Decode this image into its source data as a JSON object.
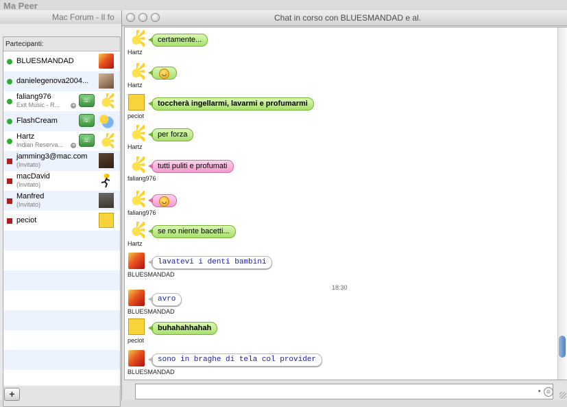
{
  "desktop": {
    "title": "Ma Peer"
  },
  "background_window": {
    "title": "Mac Forum - Il fo"
  },
  "chat_window": {
    "title": "Chat in corso con BLUESMANDAD e al."
  },
  "participants": {
    "label": "Partecipanti:",
    "items": [
      {
        "name": "BLUESMANDAD",
        "sub": "",
        "status": "online",
        "phone": false
      },
      {
        "name": "danielegenova2004...",
        "sub": "",
        "status": "online",
        "phone": false
      },
      {
        "name": "faliang976",
        "sub": "Exit Music - R...",
        "status": "online",
        "phone": true
      },
      {
        "name": "FlashCream",
        "sub": "",
        "status": "online",
        "phone": true
      },
      {
        "name": "Hartz",
        "sub": "Indian Reserva...",
        "status": "online",
        "phone": true
      },
      {
        "name": "jamming3@mac.com",
        "sub": "(Invitato)",
        "status": "invited",
        "phone": false
      },
      {
        "name": "macDavid",
        "sub": "(Invitato)",
        "status": "invited",
        "phone": false
      },
      {
        "name": "Manfred",
        "sub": "(Invitato)",
        "status": "invited",
        "phone": false
      },
      {
        "name": "peciot",
        "sub": "",
        "status": "invited",
        "phone": false
      }
    ],
    "add_label": "+"
  },
  "messages": [
    {
      "sender": "Hartz",
      "text": "certamente...",
      "style": "green"
    },
    {
      "sender": "Hartz",
      "text": "",
      "style": "green",
      "smiley": true
    },
    {
      "sender": "peciot",
      "text": "toccherà ingellarmi, lavarmi e profumarmi",
      "style": "green-bold"
    },
    {
      "sender": "Hartz",
      "text": "per forza",
      "style": "green"
    },
    {
      "sender": "faliang976",
      "text": "tutti puliti e profumati",
      "style": "pink"
    },
    {
      "sender": "faliang976",
      "text": "",
      "style": "pink",
      "smiley": true
    },
    {
      "sender": "Hartz",
      "text": "se no niente bacetti...",
      "style": "green"
    },
    {
      "sender": "BLUESMANDAD",
      "text": "lavatevi i denti bambini",
      "style": "white"
    },
    {
      "sender": "BLUESMANDAD",
      "text": "avro",
      "style": "white"
    },
    {
      "sender": "peciot",
      "text": "buhahahhahah",
      "style": "green-bold"
    },
    {
      "sender": "BLUESMANDAD",
      "text": "sono in braghe di tela col provider",
      "style": "white"
    }
  ],
  "timestamp": "18:30",
  "input": {
    "value": ""
  },
  "icons": {
    "smiley": "smiley-icon",
    "phone": "phone-icon",
    "add": "plus-icon"
  }
}
